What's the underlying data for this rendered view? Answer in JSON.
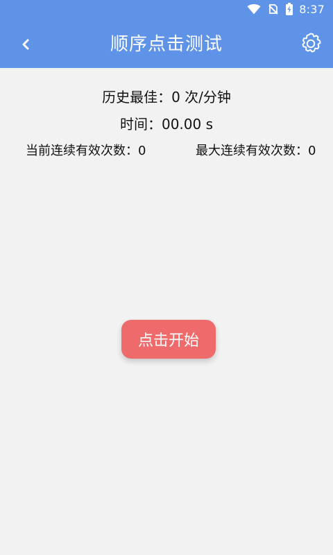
{
  "status": {
    "time": "8:37"
  },
  "header": {
    "title": "顺序点击测试"
  },
  "stats": {
    "best_prefix": "历史最佳：",
    "best_value": "0 次/分钟",
    "time_prefix": "时间：",
    "time_value": "00.00 s",
    "current_streak": "当前连续有效次数：0",
    "max_streak": "最大连续有效次数：0"
  },
  "actions": {
    "start_label": "点击开始"
  },
  "colors": {
    "header_bg": "#5f93e8",
    "page_bg": "#f2f2f2",
    "button_bg": "#ef6b6b",
    "text": "#111111"
  },
  "icons": {
    "back": "chevron-left-icon",
    "settings": "gear-icon",
    "wifi": "wifi-icon",
    "signal": "no-sim-icon",
    "battery": "battery-charging-icon"
  }
}
